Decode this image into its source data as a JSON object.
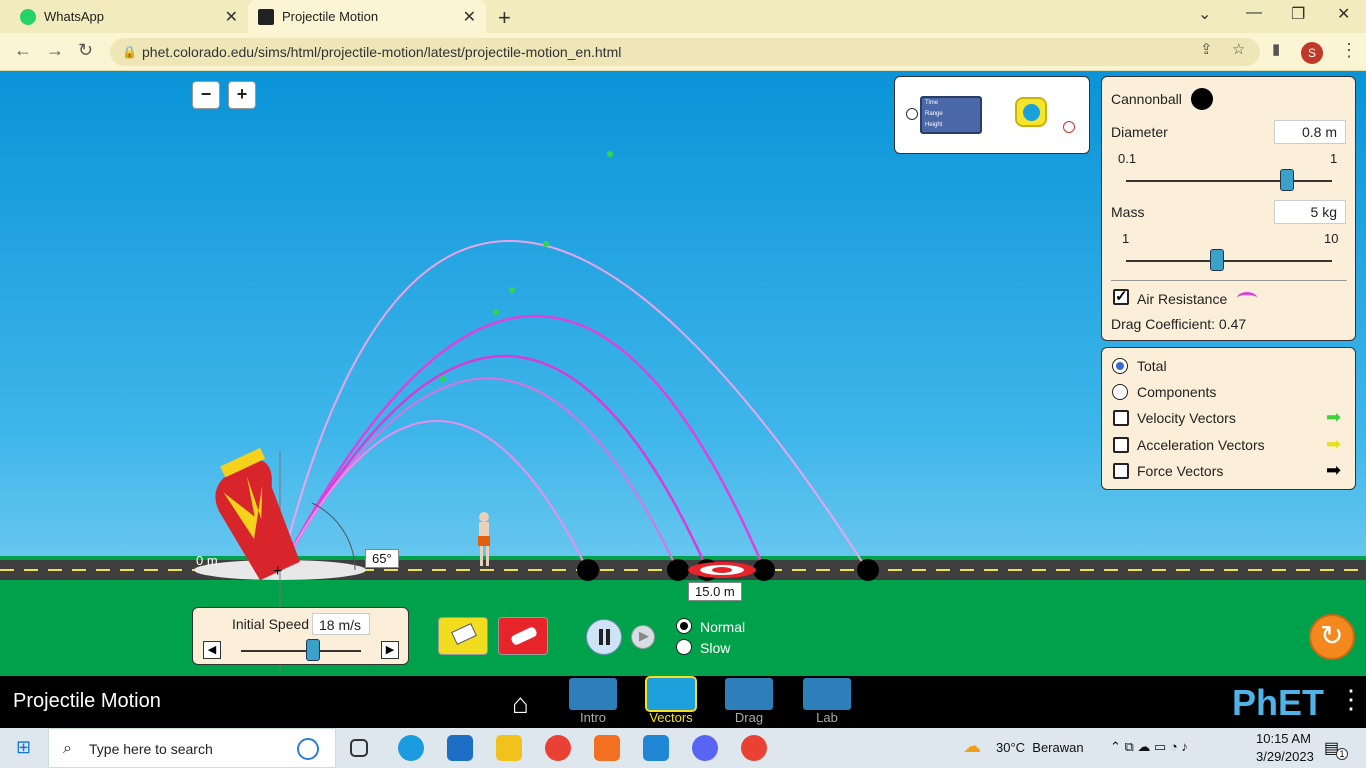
{
  "browser": {
    "tabs": [
      {
        "label": "WhatsApp"
      },
      {
        "label": "Projectile Motion"
      }
    ],
    "url": "phet.colorado.edu/sims/html/projectile-motion/latest/projectile-motion_en.html",
    "profile_initial": "S"
  },
  "toolbox": {
    "rows": [
      "Time",
      "Range",
      "Height"
    ]
  },
  "projectile_panel": {
    "projectile": "Cannonball",
    "diameter_label": "Diameter",
    "diameter_value": "0.8 m",
    "diameter_min": "0.1",
    "diameter_max": "1",
    "diameter_fraction": 0.78,
    "mass_label": "Mass",
    "mass_value": "5 kg",
    "mass_min": "1",
    "mass_max": "10",
    "mass_fraction": 0.44,
    "air_resistance_label": "Air Resistance",
    "air_resistance_checked": true,
    "drag_coefficient": "Drag Coefficient: 0.47"
  },
  "vectors_panel": {
    "total_label": "Total",
    "components_label": "Components",
    "velocity_label": "Velocity Vectors",
    "acceleration_label": "Acceleration Vectors",
    "force_label": "Force Vectors",
    "selected": "Total"
  },
  "scene": {
    "height_label": "0 m",
    "angle_label": "65°",
    "target_distance": "15.0 m",
    "initial_speed_label": "Initial Speed",
    "initial_speed_value": "18 m/s",
    "speed_fraction": 0.6
  },
  "time_controls": {
    "normal_label": "Normal",
    "slow_label": "Slow",
    "selected": "Normal"
  },
  "navbar": {
    "title": "Projectile Motion",
    "screens": [
      {
        "label": "Intro"
      },
      {
        "label": "Vectors"
      },
      {
        "label": "Drag"
      },
      {
        "label": "Lab"
      }
    ],
    "active": "Vectors",
    "logo": "PhET"
  },
  "taskbar": {
    "search_placeholder": "Type here to search",
    "weather": "30°C  Berawan",
    "time": "10:15 AM",
    "date": "3/29/2023",
    "notification_count": "1"
  },
  "colors": {
    "sky": "#0a93d8",
    "ground": "#00a14b",
    "panel": "#fcefd9",
    "trajectory": "#e040e0",
    "accent_active": "#f7e11f"
  }
}
